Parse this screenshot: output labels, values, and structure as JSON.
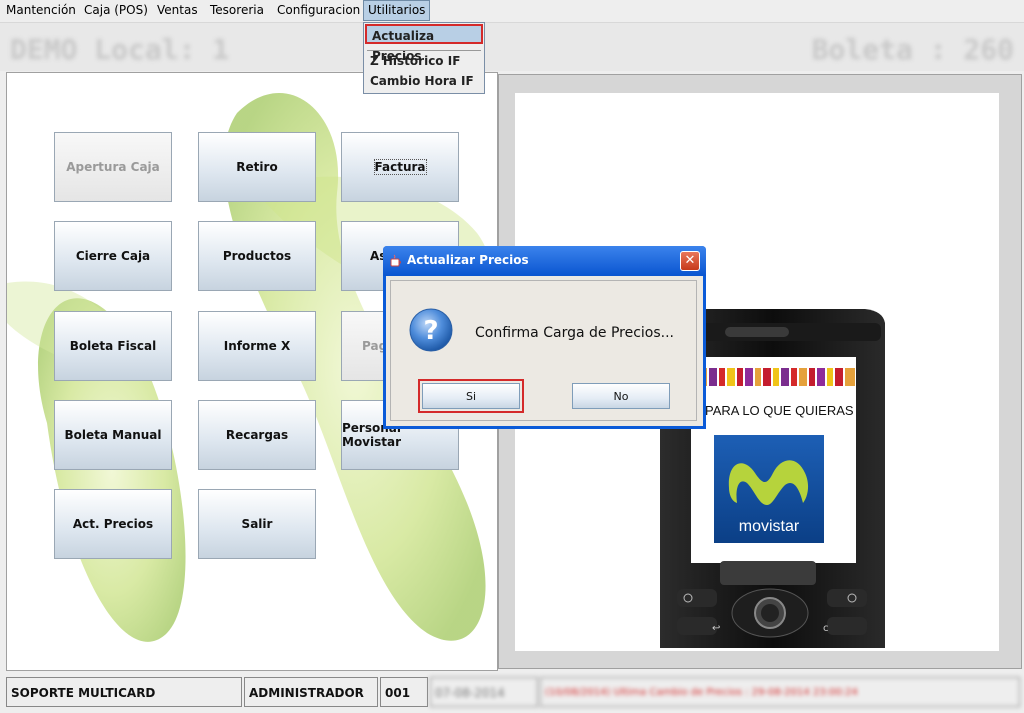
{
  "menubar": {
    "items": [
      "Mantención",
      "Caja (POS)",
      "Ventas",
      "Tesoreria",
      "Configuracion",
      "Utilitarios"
    ]
  },
  "dropdown": {
    "items": [
      "Actualiza Precios",
      "Z Histórico IF",
      "Cambio Hora IF"
    ]
  },
  "header": {
    "left_text": "DEMO Local: 1",
    "right_text": "Boleta : 260"
  },
  "buttons": {
    "apertura_caja": "Apertura Caja",
    "retiro": "Retiro",
    "factura": "Factura",
    "cierre_caja": "Cierre Caja",
    "productos": "Productos",
    "asignacion": "As",
    "boleta_fiscal": "Boleta Fiscal",
    "informe_x": "Informe X",
    "pago": "Pag",
    "boleta_manual": "Boleta Manual",
    "recargas": "Recargas",
    "personal_movistar": "Personal Movistar",
    "act_precios": "Act. Precios",
    "salir": "Salir"
  },
  "ad": {
    "slogan": "PARA LO QUE QUIERAS",
    "brand": "movistar"
  },
  "dialog": {
    "title": "Actualizar Precios",
    "message": "Confirma Carga de Precios...",
    "yes": "Si",
    "no": "No",
    "close": "✕"
  },
  "statusbar": {
    "company": "SOPORTE MULTICARD",
    "user": "ADMINISTRADOR",
    "terminal": "001",
    "date": "07-08-2014",
    "message": "(10/08/2014) Ultima Cambio de Precios : 29-08-2014 23:00:24"
  },
  "colors": {
    "dialog_title": "#0a55d0",
    "highlight_red": "#d42a2a",
    "menu_active": "#b8cfe5"
  }
}
